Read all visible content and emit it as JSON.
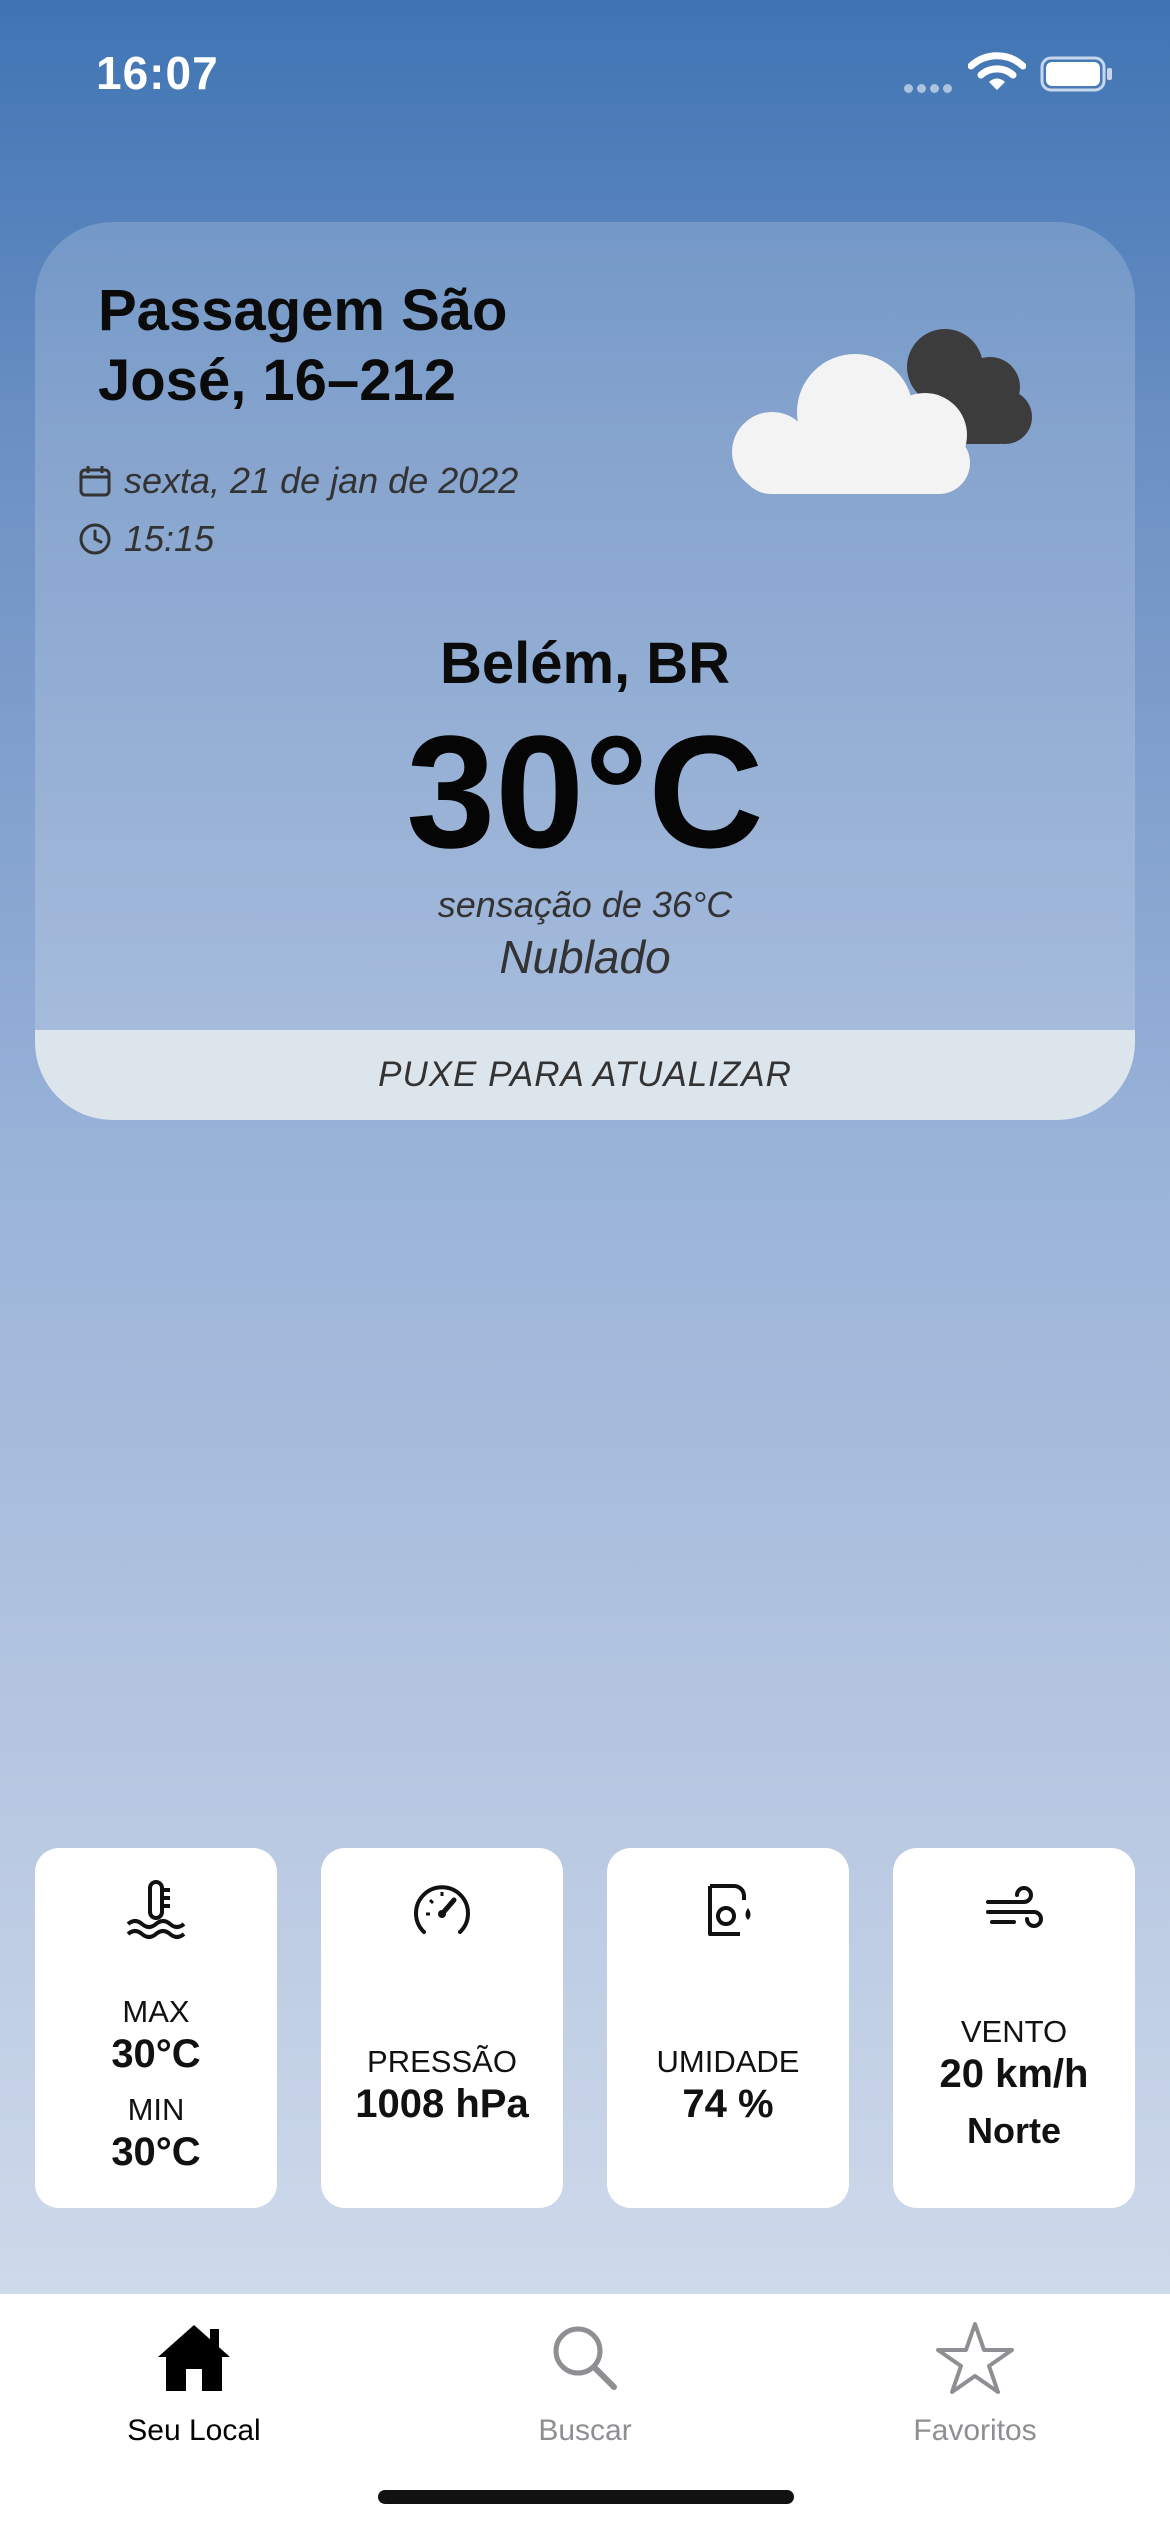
{
  "status_bar": {
    "time": "16:07"
  },
  "card": {
    "address": "Passagem São José, 16–212",
    "date": "sexta, 21 de jan de 2022",
    "time": "15:15",
    "city": "Belém, BR",
    "temperature": "30°C",
    "feels_like": "sensação de 36°C",
    "condition": "Nublado",
    "refresh_hint": "PUXE PARA ATUALIZAR",
    "weather_icon": "cloudy-icon"
  },
  "metrics": {
    "temperature": {
      "max_label": "MAX",
      "max_value": "30°C",
      "min_label": "MIN",
      "min_value": "30°C",
      "icon": "thermometer-icon"
    },
    "pressure": {
      "label": "PRESSÃO",
      "value": "1008 hPa",
      "icon": "gauge-icon"
    },
    "humidity": {
      "label": "UMIDADE",
      "value": "74 %",
      "icon": "humidity-icon"
    },
    "wind": {
      "label": "VENTO",
      "speed": "20 km/h",
      "direction": "Norte",
      "icon": "wind-icon"
    }
  },
  "tabbar": {
    "tabs": [
      {
        "label": "Seu Local",
        "icon": "home-icon",
        "active": true
      },
      {
        "label": "Buscar",
        "icon": "search-icon",
        "active": false
      },
      {
        "label": "Favoritos",
        "icon": "star-icon",
        "active": false
      }
    ]
  },
  "colors": {
    "active_tab": "#000000",
    "inactive_tab": "#8e8e93",
    "card_footer": "#dde5ec",
    "background_top": "#3f74b4",
    "background_bottom": "#d9e2ef"
  }
}
